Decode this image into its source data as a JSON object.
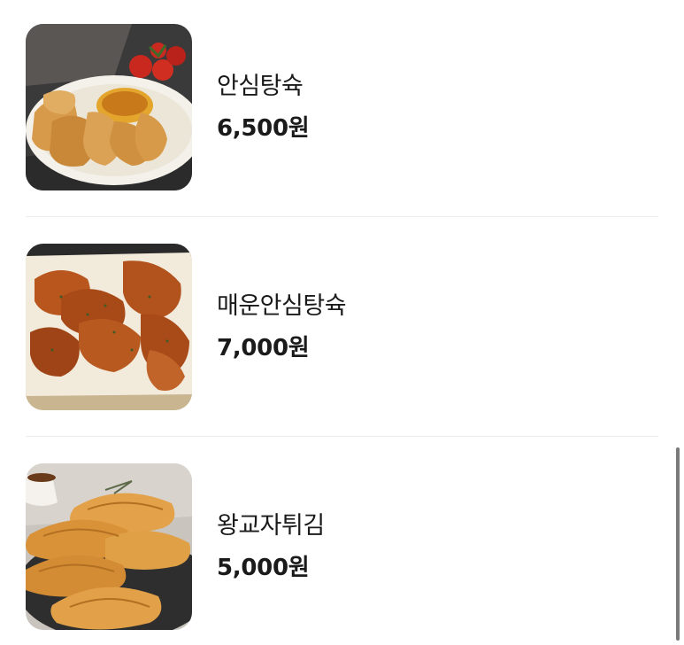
{
  "menu": {
    "items": [
      {
        "name": "안심탕슉",
        "price": "6,500원",
        "image_icon": "fried-pork-tenderloin-photo"
      },
      {
        "name": "매운안심탕슉",
        "price": "7,000원",
        "image_icon": "spicy-glazed-pork-photo"
      },
      {
        "name": "왕교자튀김",
        "price": "5,000원",
        "image_icon": "fried-dumplings-photo"
      }
    ]
  },
  "colors": {
    "text": "#1a1a1a",
    "divider": "#ececec",
    "scrollbar": "#7a7a7a"
  }
}
